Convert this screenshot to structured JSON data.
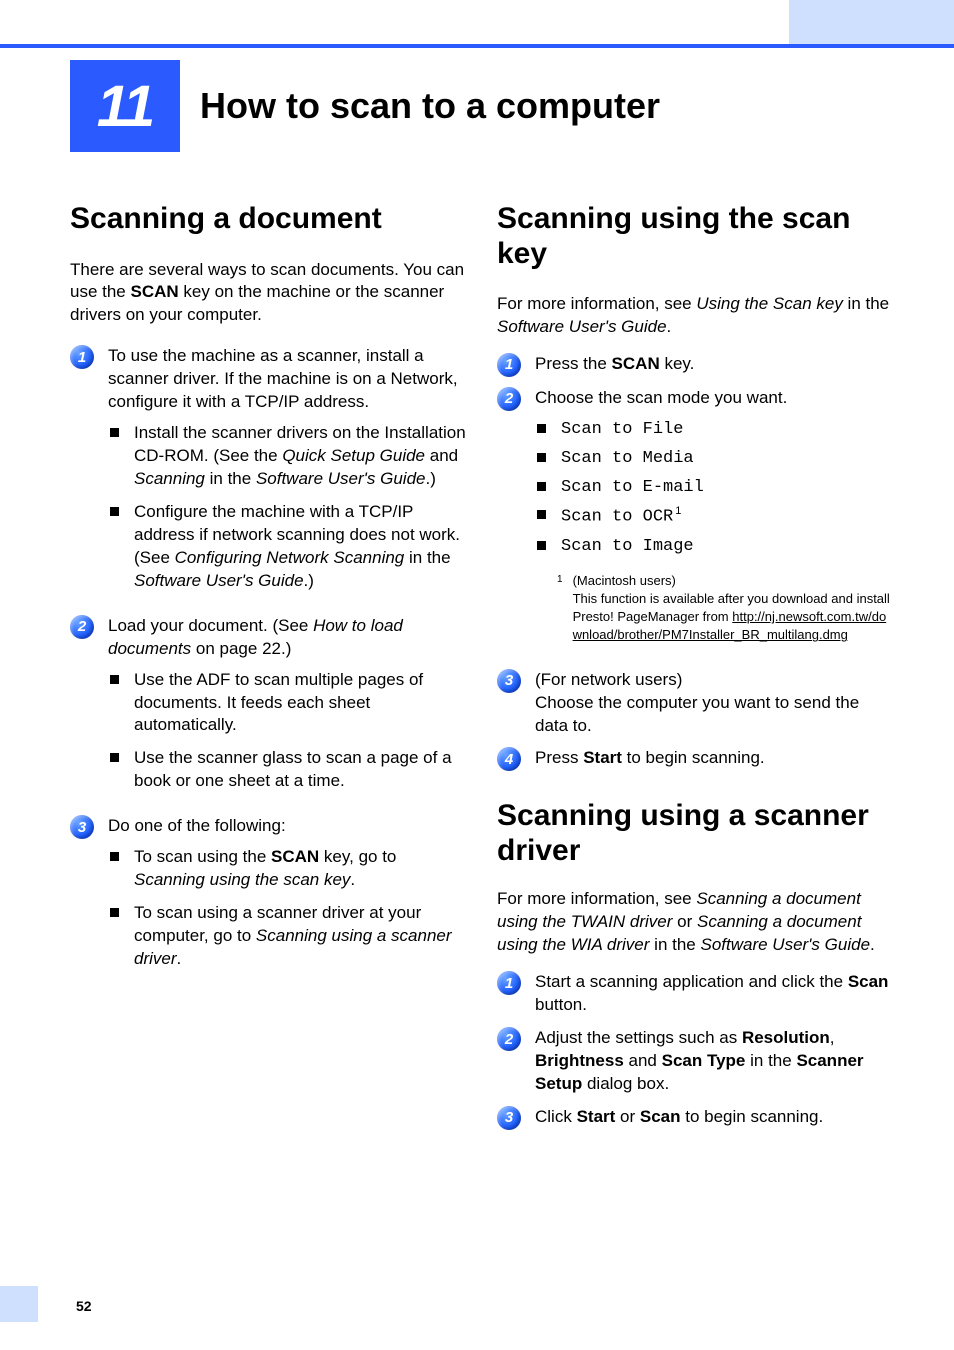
{
  "chapter": {
    "number": "11",
    "title": "How to scan to a computer"
  },
  "page_number": "52",
  "left": {
    "heading": "Scanning a document",
    "intro_pre": "There are several ways to scan documents. You can use the ",
    "intro_bold": "SCAN",
    "intro_post": " key on the machine or the scanner drivers on your computer.",
    "step1": "To use the machine as a scanner, install a scanner driver. If the machine is on a Network, configure it with a TCP/IP address.",
    "step1_sub_a_pre": "Install the scanner drivers on the Installation CD-ROM. (See the ",
    "step1_sub_a_it1": "Quick Setup Guide",
    "step1_sub_a_mid": " and ",
    "step1_sub_a_it2": "Scanning",
    "step1_sub_a_post1": " in the ",
    "step1_sub_a_it3": "Software User's Guide",
    "step1_sub_a_post2": ".)",
    "step1_sub_b_pre": "Configure the machine with a TCP/IP address if network scanning does not work. (See ",
    "step1_sub_b_it1": "Configuring Network Scanning",
    "step1_sub_b_mid": " in the ",
    "step1_sub_b_it2": "Software User's Guide",
    "step1_sub_b_post": ".)",
    "step2_pre": "Load your document. (See ",
    "step2_it": "How to load documents",
    "step2_post": " on page 22.)",
    "step2_sub_a": "Use the ADF to scan multiple pages of documents. It feeds each sheet automatically.",
    "step2_sub_b": "Use the scanner glass to scan a page of a book or one sheet at a time.",
    "step3": "Do one of the following:",
    "step3_sub_a_pre": "To scan using the ",
    "step3_sub_a_bold": "SCAN",
    "step3_sub_a_mid": " key, go to ",
    "step3_sub_a_it": "Scanning using the scan key",
    "step3_sub_a_post": ".",
    "step3_sub_b_pre": "To scan using a scanner driver at your computer, go to ",
    "step3_sub_b_it": "Scanning using a scanner driver",
    "step3_sub_b_post": "."
  },
  "right_a": {
    "heading": "Scanning using the scan key",
    "intro_pre": "For more information, see ",
    "intro_it": "Using the Scan key",
    "intro_mid": " in the ",
    "intro_it2": "Software User's Guide",
    "intro_post": ".",
    "step1_pre": "Press the ",
    "step1_bold": "SCAN",
    "step1_post": " key.",
    "step2": "Choose the scan mode you want.",
    "modes": {
      "a": "Scan to File",
      "b": "Scan to Media",
      "c": "Scan to E-mail",
      "d": "Scan to OCR",
      "e": "Scan to Image"
    },
    "fnref": "1",
    "footnote_mark": "1",
    "footnote_l1": "(Macintosh users)",
    "footnote_l2": "This function is available after you download and install Presto! PageManager from ",
    "footnote_link": "http://nj.newsoft.com.tw/download/brother/PM7Installer_BR_multilang.dmg",
    "step3_l1": "(For network users)",
    "step3_l2": "Choose the computer you want to send the data to.",
    "step4_pre": "Press ",
    "step4_bold": "Start",
    "step4_post": " to begin scanning."
  },
  "right_b": {
    "heading": "Scanning using a scanner driver",
    "intro_pre": "For more information, see ",
    "intro_it1": "Scanning a document using the TWAIN driver",
    "intro_mid1": " or ",
    "intro_it2": "Scanning a document using the WIA driver",
    "intro_mid2": " in the ",
    "intro_it3": "Software User's Guide",
    "intro_post": ".",
    "step1_pre": "Start a scanning application and click the ",
    "step1_bold": "Scan",
    "step1_post": " button.",
    "step2_pre": "Adjust the settings such as ",
    "step2_b1": "Resolution",
    "step2_c1": ", ",
    "step2_b2": "Brightness",
    "step2_c2": " and ",
    "step2_b3": "Scan Type",
    "step2_c3": " in the ",
    "step2_b4": "Scanner Setup",
    "step2_post": " dialog box.",
    "step3_pre": "Click ",
    "step3_b1": "Start",
    "step3_mid": " or ",
    "step3_b2": "Scan",
    "step3_post": " to begin scanning."
  }
}
